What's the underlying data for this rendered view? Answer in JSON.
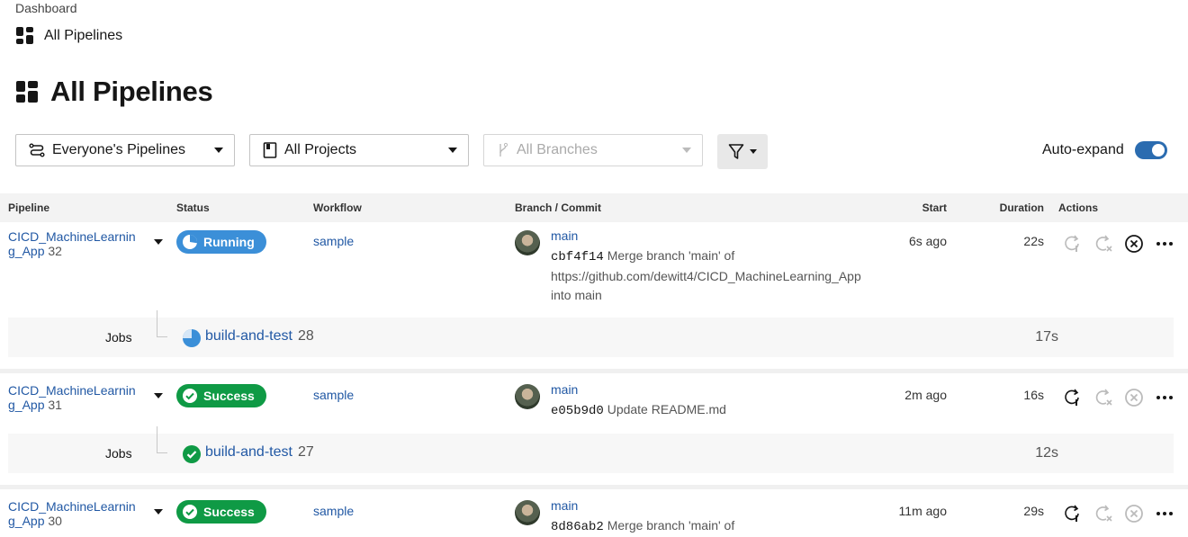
{
  "breadcrumb": "Dashboard",
  "subnav_title": "All Pipelines",
  "page_title": "All Pipelines",
  "filters": {
    "pipelines": "Everyone's Pipelines",
    "projects": "All Projects",
    "branches_placeholder": "All Branches"
  },
  "auto_expand": {
    "label": "Auto-expand",
    "on": true
  },
  "columns": {
    "pipeline": "Pipeline",
    "status": "Status",
    "workflow": "Workflow",
    "branch_commit": "Branch / Commit",
    "start": "Start",
    "duration": "Duration",
    "actions": "Actions"
  },
  "rows": [
    {
      "name": "CICD_MachineLearnin​g_App",
      "number": "32",
      "status": "Running",
      "workflow": "sample",
      "branch": "main",
      "sha": "cbf4f14",
      "message": "Merge branch 'main' of https://github.com/dewitt4/CICD_MachineLearning_App into main",
      "start": "6s ago",
      "duration": "22s",
      "job": {
        "label": "Jobs",
        "name": "build-and-test",
        "number": "28",
        "duration": "17s"
      }
    },
    {
      "name": "CICD_MachineLearnin​g_App",
      "number": "31",
      "status": "Success",
      "workflow": "sample",
      "branch": "main",
      "sha": "e05b9d0",
      "message": "Update README.md",
      "start": "2m ago",
      "duration": "16s",
      "job": {
        "label": "Jobs",
        "name": "build-and-test",
        "number": "27",
        "duration": "12s"
      }
    },
    {
      "name": "CICD_MachineLearnin​g_App",
      "number": "30",
      "status": "Success",
      "workflow": "sample",
      "branch": "main",
      "sha": "8d86ab2",
      "message": "Merge branch 'main' of",
      "start": "11m ago",
      "duration": "29s"
    }
  ],
  "colors": {
    "link": "#2158a4",
    "running": "#3b8fd8",
    "success": "#0f9a45",
    "toggle": "#2b6cb0"
  }
}
